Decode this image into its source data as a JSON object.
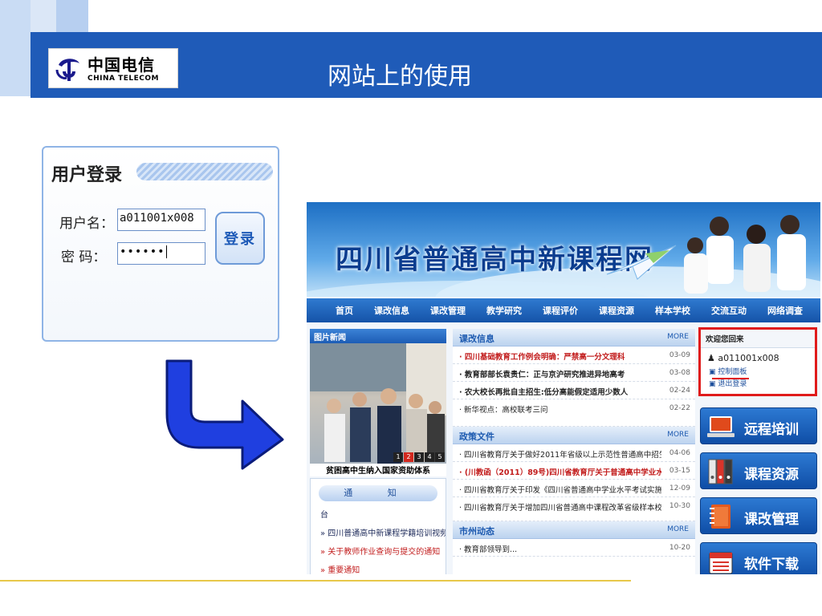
{
  "header": {
    "slide_title": "网站上的使用",
    "logo_cn": "中国电信",
    "logo_en": "CHINA TELECOM",
    "bar_color": "#1f5bb8"
  },
  "login": {
    "title": "用户登录",
    "username_label": "用户名：",
    "password_label": "密  码：",
    "username_value": "a011001x008",
    "password_value": "••••••",
    "submit_label": "登录"
  },
  "site": {
    "banner_title": "四川省普通高中新课程网",
    "nav": [
      "首页",
      "课改信息",
      "课改管理",
      "教学研究",
      "课程评价",
      "课程资源",
      "样本学校",
      "交流互动",
      "网络调查"
    ],
    "pic_news": {
      "title": "图片新闻",
      "caption": "贫困高中生纳入国家资助体系",
      "pages": [
        "1",
        "2",
        "3",
        "4",
        "5"
      ]
    },
    "notice": {
      "title": "通 知",
      "items": [
        {
          "text": "台",
          "red": false
        },
        {
          "text": "» 四川普通高中新课程学籍培训视频",
          "red": false
        },
        {
          "text": "» 关于教师作业查询与提交的通知",
          "red": true
        },
        {
          "text": "» 重要通知",
          "red": true
        }
      ]
    },
    "sections": [
      {
        "title": "课改信息",
        "more": "MORE",
        "items": [
          {
            "title": "· 四川基础教育工作例会明确：严禁高一分文理科",
            "date": "03-09",
            "style": "red"
          },
          {
            "title": "· 教育部部长袁贵仁：正与京沪研究推进异地高考",
            "date": "03-08",
            "style": "bold"
          },
          {
            "title": "· 农大校长再批自主招生:低分高能假定适用少数人",
            "date": "02-24",
            "style": "bold"
          },
          {
            "title": "· 新华视点：高校联考三问",
            "date": "02-22",
            "style": "normal"
          }
        ]
      },
      {
        "title": "政策文件",
        "more": "MORE",
        "items": [
          {
            "title": "· 四川省教育厅关于做好2011年省级以上示范性普通高中招生改革工",
            "date": "04-06",
            "style": "normal"
          },
          {
            "title": "· (川教函（2011）89号)四川省教育厅关于普通高中学业水平考试科",
            "date": "03-15",
            "style": "red"
          },
          {
            "title": "· 四川省教育厅关于印发《四川省普通高中学业水平考试实施办法(",
            "date": "12-09",
            "style": "normal"
          },
          {
            "title": "· 四川省教育厅关于增加四川省普通高中课程改革省级样本校的通知",
            "date": "10-30",
            "style": "normal"
          }
        ]
      },
      {
        "title": "市州动态",
        "more": "MORE",
        "items": [
          {
            "title": "· 教育部领导到...",
            "date": "10-20",
            "style": "normal"
          }
        ]
      }
    ],
    "welcome": {
      "title": "欢迎您回来",
      "user": "a011001x008",
      "control_panel": "控制面板",
      "logout": "退出登录"
    },
    "side_buttons": [
      {
        "label": "远程培训",
        "icon": "laptop-icon"
      },
      {
        "label": "课程资源",
        "icon": "binders-icon"
      },
      {
        "label": "课改管理",
        "icon": "notebook-icon"
      },
      {
        "label": "软件下载",
        "icon": "window-list-icon"
      }
    ]
  }
}
